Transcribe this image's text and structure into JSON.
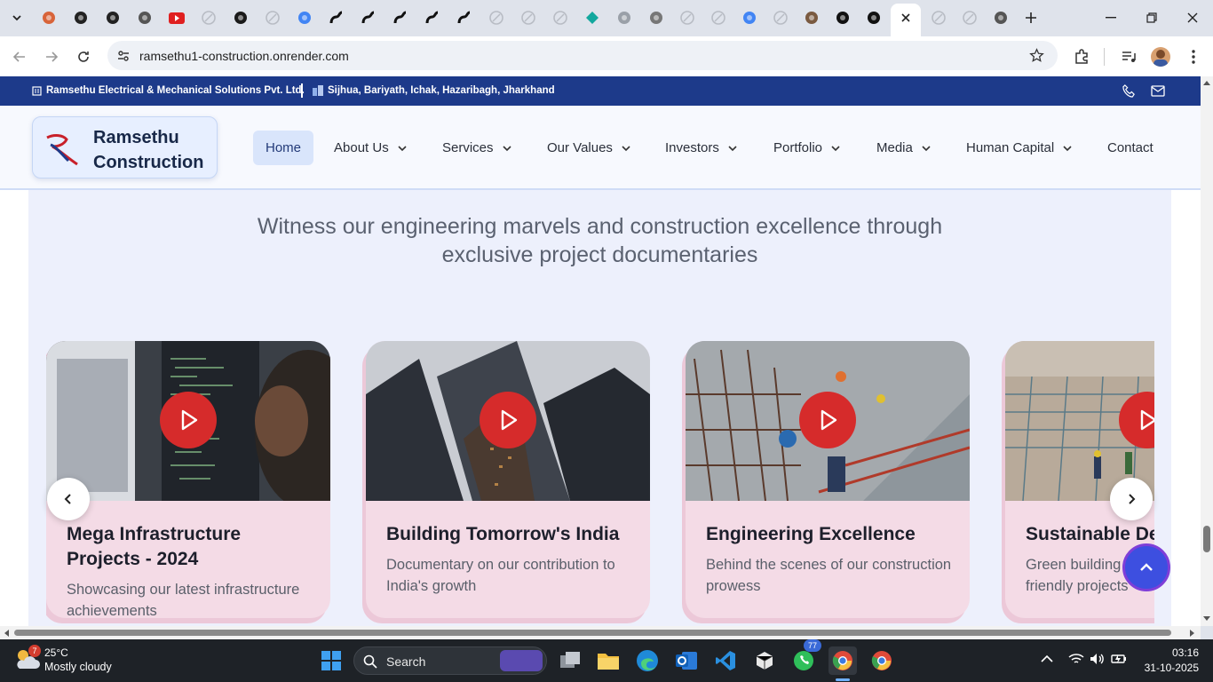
{
  "browser": {
    "url": "ramsethu1-construction.onrender.com",
    "tab_icons": [
      "claude-icon",
      "openai-icon",
      "x-icon",
      "chrome-icon",
      "youtube-icon",
      "blank-icon",
      "perplexity-icon",
      "blank-icon",
      "google-icon",
      "render-icon",
      "render-icon",
      "render-icon",
      "render-icon",
      "render-icon",
      "blank-icon",
      "blank-icon",
      "blank-icon",
      "gemini-icon",
      "vercel-icon",
      "grid-icon",
      "blank-icon",
      "blank-icon",
      "google-icon",
      "blank-icon",
      "avatar-icon",
      "github-icon",
      "github-icon",
      "close-icon",
      "blank-icon",
      "blank-icon",
      "chrome-icon"
    ]
  },
  "topbar": {
    "company": "Ramsethu Electrical & Mechanical Solutions Pvt. Ltd.",
    "address": "Sijhua, Bariyath, Ichak, Hazaribagh, Jharkhand"
  },
  "logo": {
    "line1": "Ramsethu",
    "line2": "Construction"
  },
  "nav": {
    "home": "Home",
    "about": "About Us",
    "services": "Services",
    "values": "Our Values",
    "investors": "Investors",
    "portfolio": "Portfolio",
    "media": "Media",
    "human": "Human Capital",
    "contact": "Contact"
  },
  "section": {
    "subtitle_line1": "Witness our engineering marvels and construction excellence through",
    "subtitle_line2": "exclusive project documentaries"
  },
  "cards": [
    {
      "title": "Mega Infrastructure Projects - 2024",
      "desc": "Showcasing our latest infrastructure achievements"
    },
    {
      "title": "Building Tomorrow's India",
      "desc": "Documentary on our contribution to India's growth"
    },
    {
      "title": "Engineering Excellence",
      "desc": "Behind the scenes of our construction prowess"
    },
    {
      "title": "Sustainable De",
      "desc": "Green building friendly projects"
    }
  ],
  "taskbar": {
    "weather_badge": "7",
    "temperature": "25°C",
    "condition": "Mostly cloudy",
    "search": "Search",
    "whatsapp_badge": "77",
    "time": "03:16",
    "date": "31-10-2025"
  },
  "colors": {
    "brand_blue": "#1d3a8a",
    "play_red": "#d62b2b",
    "card_pink": "#f4dbe6"
  }
}
